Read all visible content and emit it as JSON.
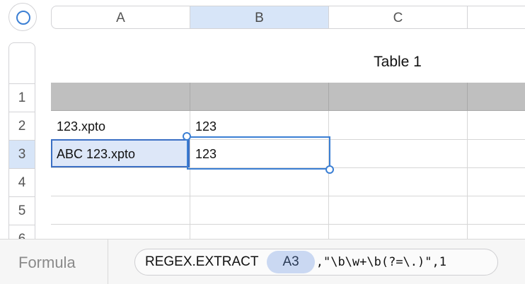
{
  "columns": [
    {
      "label": "A",
      "selected": false
    },
    {
      "label": "B",
      "selected": true
    },
    {
      "label": "C",
      "selected": false
    }
  ],
  "rows": [
    {
      "label": "1",
      "selected": false
    },
    {
      "label": "2",
      "selected": false
    },
    {
      "label": "3",
      "selected": true
    },
    {
      "label": "4",
      "selected": false
    },
    {
      "label": "5",
      "selected": false
    },
    {
      "label": "6",
      "selected": false
    }
  ],
  "table": {
    "title": "Table 1",
    "cells": {
      "A2": "123.xpto",
      "B2": "123",
      "A3": "ABC 123.xpto",
      "B3": "123"
    }
  },
  "formula_bar": {
    "label": "Formula",
    "function_name": "REGEX.EXTRACT",
    "reference": "A3",
    "arguments": ",\"\\b\\w+\\b(?=\\.)\",1"
  },
  "colors": {
    "selection": "#3b7fd4",
    "selected_header": "#d7e5f8",
    "table_header_row": "#bfbfbf",
    "reference_token": "#cad8f2"
  }
}
